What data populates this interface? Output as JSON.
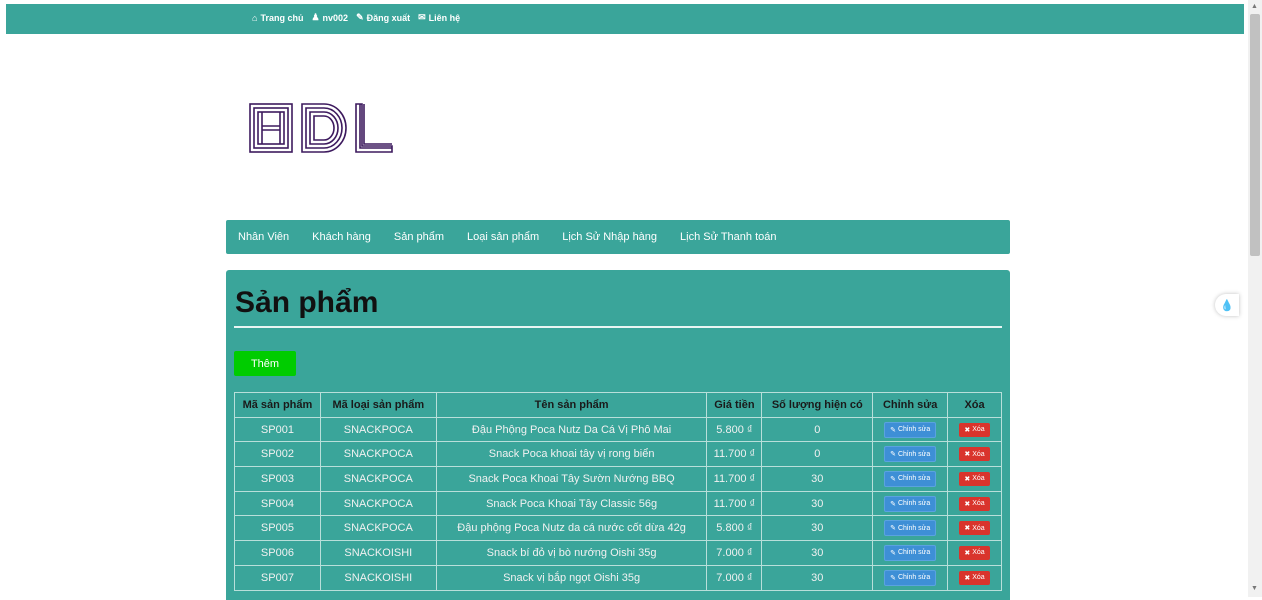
{
  "topnav": {
    "home": "Trang chủ",
    "user": "nv002",
    "logout": "Đăng xuất",
    "contact": "Liên hệ"
  },
  "logo": {
    "text": "HDL",
    "color": "#3d1a5e"
  },
  "mainnav": {
    "items": [
      "Nhân Viên",
      "Khách hàng",
      "Sản phẩm",
      "Loại sản phẩm",
      "Lịch Sử Nhập hàng",
      "Lịch Sử Thanh toán"
    ]
  },
  "page": {
    "title": "Sản phẩm",
    "add_label": "Thêm"
  },
  "table": {
    "headers": [
      "Mã sản phẩm",
      "Mã loại sản phẩm",
      "Tên sản phẩm",
      "Giá tiền",
      "Số lượng hiện có",
      "Chỉnh sửa",
      "Xóa"
    ],
    "edit_label": "Chỉnh sửa",
    "delete_label": "Xóa",
    "rows": [
      [
        "SP001",
        "SNACKPOCA",
        "Đậu Phộng Poca Nutz Da Cá Vị Phô Mai",
        "5.800 ₫",
        "0"
      ],
      [
        "SP002",
        "SNACKPOCA",
        "Snack Poca khoai tây vị rong biển",
        "11.700 ₫",
        "0"
      ],
      [
        "SP003",
        "SNACKPOCA",
        "Snack Poca Khoai Tây Sườn Nướng BBQ",
        "11.700 ₫",
        "30"
      ],
      [
        "SP004",
        "SNACKPOCA",
        "Snack Poca Khoai Tây Classic 56g",
        "11.700 ₫",
        "30"
      ],
      [
        "SP005",
        "SNACKPOCA",
        "Đậu phộng Poca Nutz da cá nước cốt dừa 42g",
        "5.800 ₫",
        "30"
      ],
      [
        "SP006",
        "SNACKOISHI",
        "Snack bí đỏ vị bò nướng Oishi 35g",
        "7.000 ₫",
        "30"
      ],
      [
        "SP007",
        "SNACKOISHI",
        "Snack vị bắp ngọt Oishi 35g",
        "7.000 ₫",
        "30"
      ]
    ]
  },
  "colors": {
    "teal": "#3aa59a",
    "add": "#00cc00",
    "edit": "#3e8fd6",
    "delete": "#d9342c"
  }
}
